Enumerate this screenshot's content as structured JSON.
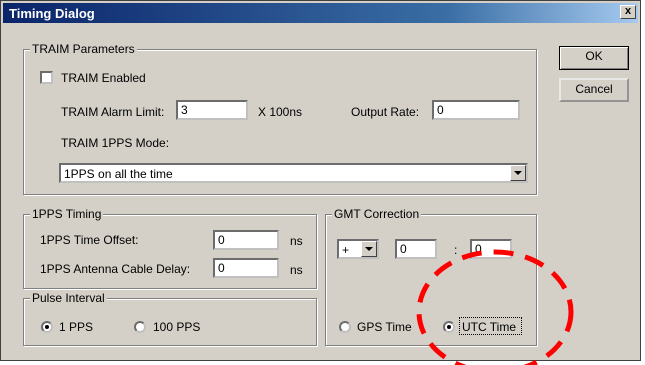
{
  "window": {
    "title": "Timing Dialog",
    "close_label": "x"
  },
  "buttons": {
    "ok": "OK",
    "cancel": "Cancel"
  },
  "traim": {
    "legend": "TRAIM Parameters",
    "enabled_label": "TRAIM Enabled",
    "enabled_checked": false,
    "alarm_limit_label": "TRAIM Alarm Limit:",
    "alarm_limit_value": "3",
    "alarm_unit": "X 100ns",
    "output_rate_label": "Output Rate:",
    "output_rate_value": "0",
    "mode_label": "TRAIM 1PPS Mode:",
    "mode_value": "1PPS on all the time"
  },
  "pps_timing": {
    "legend": "1PPS Timing",
    "offset_label": "1PPS Time Offset:",
    "offset_value": "0",
    "offset_unit": "ns",
    "cable_label": "1PPS Antenna Cable Delay:",
    "cable_value": "0",
    "cable_unit": "ns"
  },
  "pulse_interval": {
    "legend": "Pulse Interval",
    "opt1": "1 PPS",
    "opt2": "100 PPS",
    "selected": "1 PPS"
  },
  "gmt": {
    "legend": "GMT Correction",
    "sign_value": "+",
    "hours_value": "0",
    "separator": ":",
    "minutes_value": "0",
    "opt_gps": "GPS Time",
    "opt_utc": "UTC Time",
    "selected": "UTC Time"
  },
  "colors": {
    "title_bar": "#0a246a",
    "face": "#d4d0c8",
    "annotation": "#ff0000"
  }
}
